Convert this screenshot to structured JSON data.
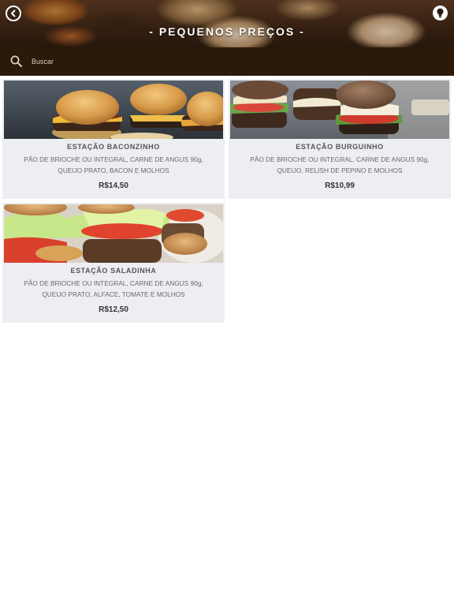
{
  "header": {
    "title": "- PEQUENOS PREÇOS -",
    "back_icon": "back-icon",
    "info_icon": "info-icon"
  },
  "search": {
    "placeholder": "Buscar",
    "icon": "search-icon"
  },
  "products": [
    {
      "name": "ESTAÇÃO BACONZINHO",
      "description": "PÃO DE BRIOCHE OU INTEGRAL, CARNE DE ANGUS 90g, QUEIJO PRATO, BACON E MOLHOS",
      "price": "R$14,50"
    },
    {
      "name": "ESTAÇÃO BURGUINHO",
      "description": "PÃO DE BRIOCHE OU INTEGRAL, CARNE DE ANGUS 90g, QUEIJO, RELISH DE PEPINO E MOLHOS",
      "price": "R$10,99"
    },
    {
      "name": "ESTAÇÃO SALADINHA",
      "description": "PÃO DE BRIOCHE OU INTEGRAL, CARNE DE ANGUS 90g, QUEIJO PRATO, ALFACE, TOMATE E MOLHOS",
      "price": "R$12,50"
    }
  ],
  "colors": {
    "search_bar": "#2b1a07",
    "card_bg": "#eceef2"
  }
}
